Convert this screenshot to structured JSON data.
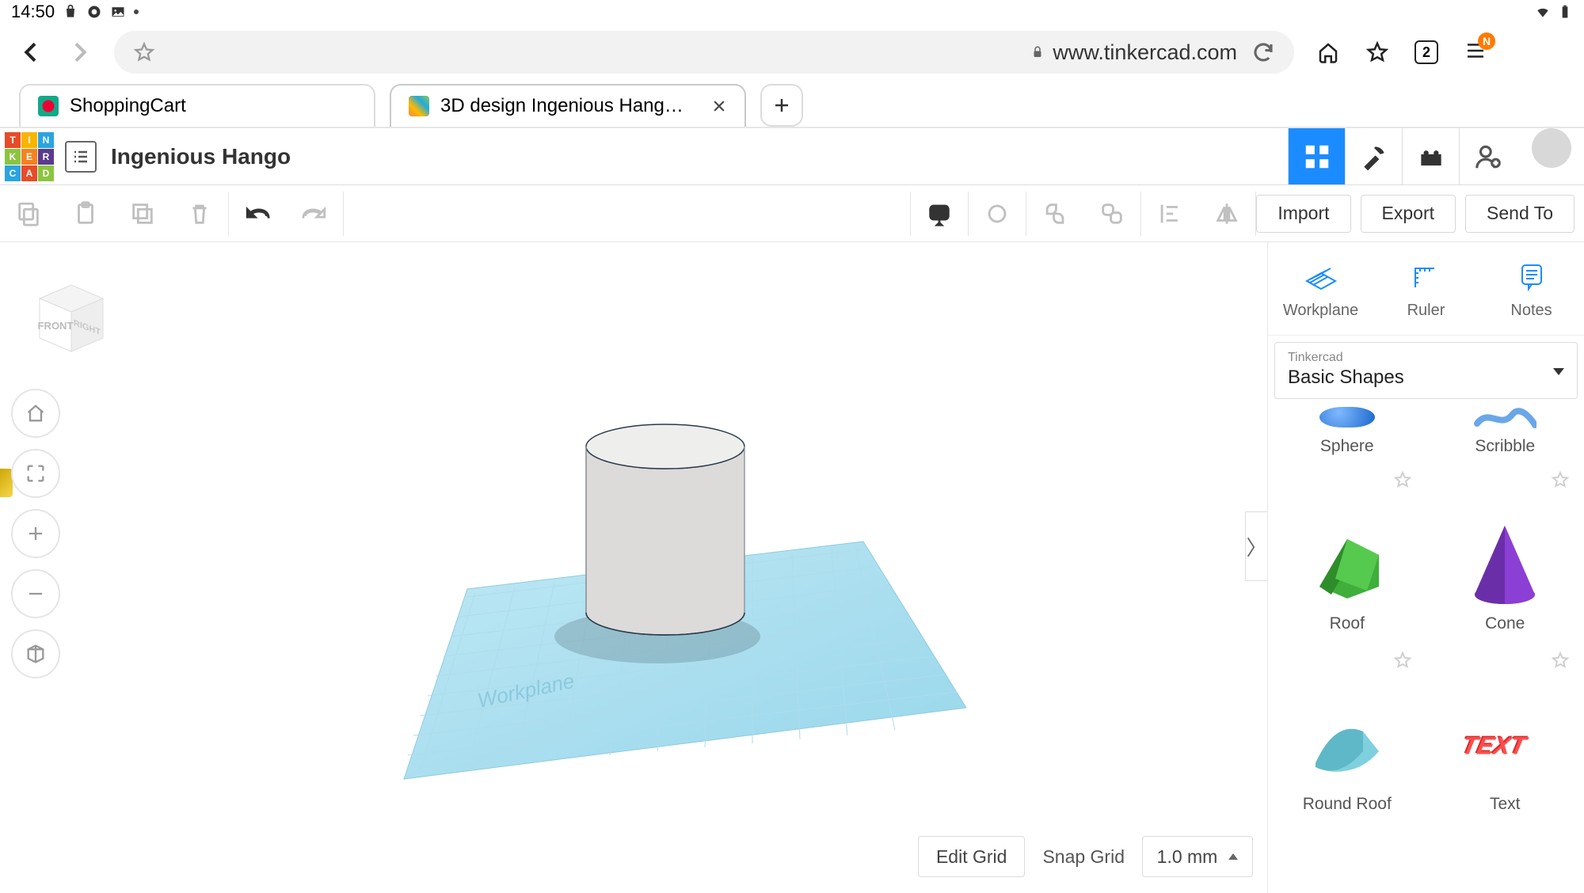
{
  "status": {
    "time": "14:50",
    "tab_count": "2",
    "menu_badge": "N"
  },
  "browser": {
    "url": "www.tinkercad.com",
    "tabs": [
      {
        "title": "ShoppingCart",
        "active": false
      },
      {
        "title": "3D design Ingenious Hang…",
        "active": true
      }
    ]
  },
  "app": {
    "logo_letters": [
      "T",
      "I",
      "N",
      "K",
      "E",
      "R",
      "C",
      "A",
      "D"
    ],
    "logo_colors": [
      "#e84b28",
      "#f7b500",
      "#2aa4e0",
      "#8bc53f",
      "#f58220",
      "#5a3b8e",
      "#2aa4e0",
      "#e84b28",
      "#8bc53f"
    ],
    "document_title": "Ingenious Hango"
  },
  "toolbar": {
    "import": "Import",
    "export": "Export",
    "send_to": "Send To"
  },
  "right_panel": {
    "tools": {
      "workplane": "Workplane",
      "ruler": "Ruler",
      "notes": "Notes"
    },
    "library_small": "Tinkercad",
    "library_name": "Basic Shapes",
    "shapes": [
      {
        "name": "Sphere"
      },
      {
        "name": "Scribble"
      },
      {
        "name": "Roof"
      },
      {
        "name": "Cone"
      },
      {
        "name": "Round Roof"
      },
      {
        "name": "Text"
      }
    ]
  },
  "viewcube": {
    "front": "FRONT",
    "right": "RIGHT"
  },
  "grid": {
    "edit": "Edit Grid",
    "snap_label": "Snap Grid",
    "snap_value": "1.0 mm",
    "workplane_watermark": "Workplane"
  }
}
